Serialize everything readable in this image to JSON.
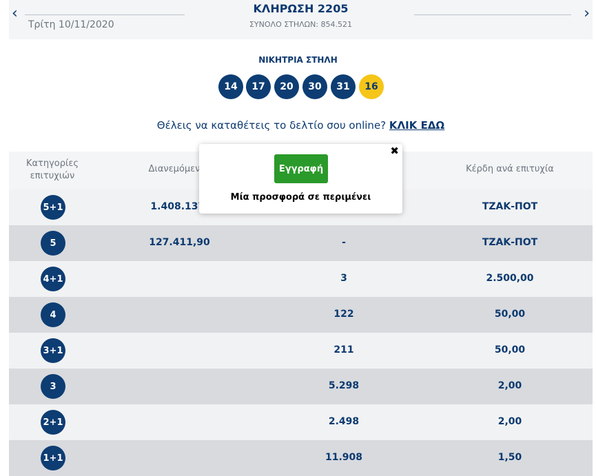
{
  "header": {
    "prev_icon": "‹",
    "next_icon": "›",
    "date": "Τρίτη 10/11/2020",
    "draw_title": "ΚΛΗΡΩΣΗ 2205",
    "total_columns": "ΣΥΝΟΛΟ ΣΤΗΛΩΝ: 854.521"
  },
  "winning": {
    "label": "ΝΙΚΗΤΡΙΑ ΣΤΗΛΗ",
    "numbers": [
      "14",
      "17",
      "20",
      "30",
      "31"
    ],
    "joker": "16"
  },
  "cta": {
    "text": "Θέλεις να καταθέτεις το δελτίο σου online? ",
    "link": "ΚΛΙΚ ΕΔΩ"
  },
  "table": {
    "headers": {
      "categories": "Κατηγορίες επιτυχιών",
      "distributed": "Διανεμόμεν",
      "prize": "Κέρδη ανά επιτυχία"
    },
    "rows": [
      {
        "cat": "5+1",
        "distributed": "1.408.137,",
        "winners": "",
        "prize": "ΤΖΑΚ-ΠΟΤ"
      },
      {
        "cat": "5",
        "distributed": "127.411,90",
        "winners": "-",
        "prize": "ΤΖΑΚ-ΠΟΤ"
      },
      {
        "cat": "4+1",
        "distributed": "",
        "winners": "3",
        "prize": "2.500,00"
      },
      {
        "cat": "4",
        "distributed": "",
        "winners": "122",
        "prize": "50,00"
      },
      {
        "cat": "3+1",
        "distributed": "",
        "winners": "211",
        "prize": "50,00"
      },
      {
        "cat": "3",
        "distributed": "",
        "winners": "5.298",
        "prize": "2,00"
      },
      {
        "cat": "2+1",
        "distributed": "",
        "winners": "2.498",
        "prize": "2,00"
      },
      {
        "cat": "1+1",
        "distributed": "",
        "winners": "11.908",
        "prize": "1,50"
      }
    ]
  },
  "popup": {
    "close_icon": "✖",
    "register_label": "Εγγραφή",
    "offer_text": "Μία προσφορά σε περιμένει"
  },
  "colors": {
    "navy": "#0d3d73",
    "joker": "#f5c518",
    "register_green": "#2a9a2a"
  }
}
